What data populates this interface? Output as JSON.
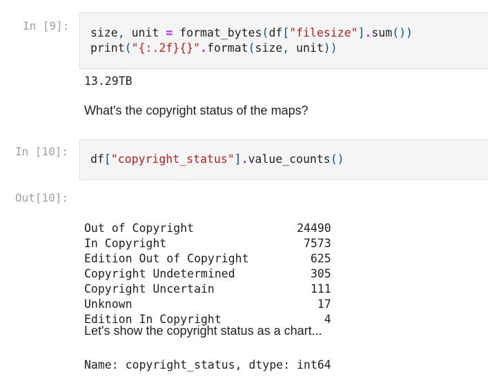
{
  "cell9": {
    "prompt": "In [9]:",
    "code": {
      "line1": {
        "a": "size",
        "b": ",",
        "c": " unit ",
        "d": "=",
        "e": " format_bytes",
        "f": "(",
        "g": "df",
        "h": "[",
        "i": "\"filesize\"",
        "j": "]",
        "k": ".",
        "l": "sum",
        "m": "())"
      },
      "line2": {
        "a": "print",
        "b": "(",
        "c": "\"{:.2f}{}\"",
        "d": ".",
        "e": "format",
        "f": "(",
        "g": "size",
        "h": ",",
        "i": " unit",
        "j": "))"
      }
    },
    "output": "13.29TB"
  },
  "markdown1": "What's the copyright status of the maps?",
  "cell10": {
    "prompt": "In [10]:",
    "code": {
      "a": "df",
      "b": "[",
      "c": "\"copyright_status\"",
      "d": "]",
      "e": ".",
      "f": "value_counts",
      "g": "()"
    },
    "out_prompt": "Out[10]:",
    "rows": [
      {
        "label": "Out of Copyright",
        "count": "24490"
      },
      {
        "label": "In Copyright",
        "count": "7573"
      },
      {
        "label": "Edition Out of Copyright",
        "count": "625"
      },
      {
        "label": "Copyright Undetermined",
        "count": "305"
      },
      {
        "label": "Copyright Uncertain",
        "count": "111"
      },
      {
        "label": "Unknown",
        "count": "17"
      },
      {
        "label": "Edition In Copyright",
        "count": "4"
      }
    ],
    "footer": "Name: copyright_status, dtype: int64"
  },
  "markdown2": "Let's show the copyright status as a chart..."
}
